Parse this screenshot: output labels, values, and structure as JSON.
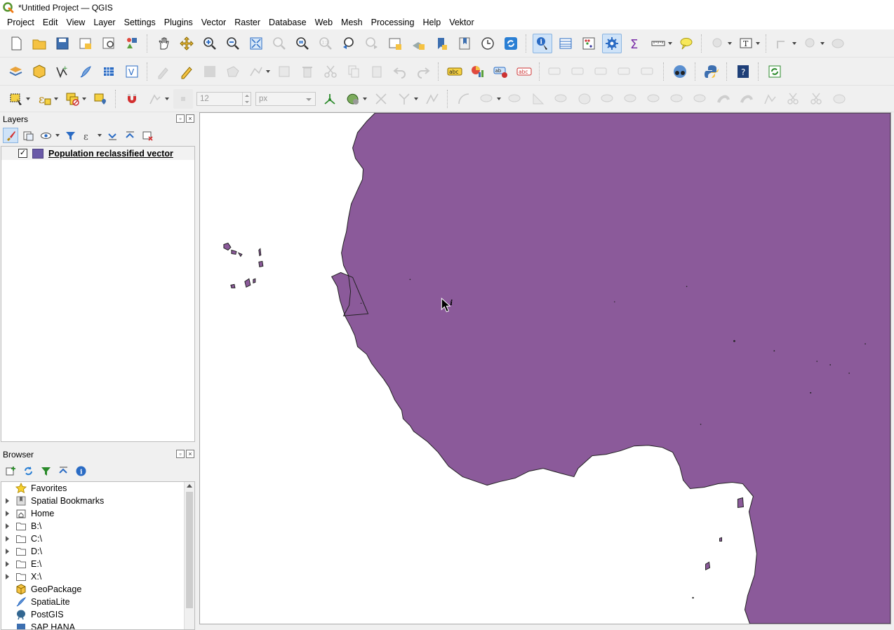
{
  "window": {
    "title": "*Untitled Project — QGIS"
  },
  "menubar": {
    "items": [
      "Project",
      "Edit",
      "View",
      "Layer",
      "Settings",
      "Plugins",
      "Vector",
      "Raster",
      "Database",
      "Web",
      "Mesh",
      "Processing",
      "Help",
      "Vektor"
    ]
  },
  "digitizing": {
    "tolerance_value": "12",
    "tolerance_unit": "px"
  },
  "layers_panel": {
    "title": "Layers",
    "layers": [
      {
        "name": "Population reclassified vector",
        "checked": true,
        "color": "#6a5aa8"
      }
    ]
  },
  "browser_panel": {
    "title": "Browser",
    "items": [
      {
        "label": "Favorites",
        "icon": "star-icon",
        "expandable": false
      },
      {
        "label": "Spatial Bookmarks",
        "icon": "bookmark-icon",
        "expandable": true
      },
      {
        "label": "Home",
        "icon": "home-folder-icon",
        "expandable": true
      },
      {
        "label": "B:\\",
        "icon": "folder-icon",
        "expandable": true
      },
      {
        "label": "C:\\",
        "icon": "folder-icon",
        "expandable": true
      },
      {
        "label": "D:\\",
        "icon": "folder-icon",
        "expandable": true
      },
      {
        "label": "E:\\",
        "icon": "folder-icon",
        "expandable": true
      },
      {
        "label": "X:\\",
        "icon": "folder-icon",
        "expandable": true
      },
      {
        "label": "GeoPackage",
        "icon": "geopackage-icon",
        "expandable": false
      },
      {
        "label": "SpatiaLite",
        "icon": "spatialite-icon",
        "expandable": false
      },
      {
        "label": "PostGIS",
        "icon": "postgis-icon",
        "expandable": false
      },
      {
        "label": "SAP HANA",
        "icon": "database-icon",
        "expandable": false
      }
    ]
  },
  "map": {
    "fill_color": "#8b5a9a",
    "stroke_color": "#222222",
    "background": "#ffffff"
  }
}
